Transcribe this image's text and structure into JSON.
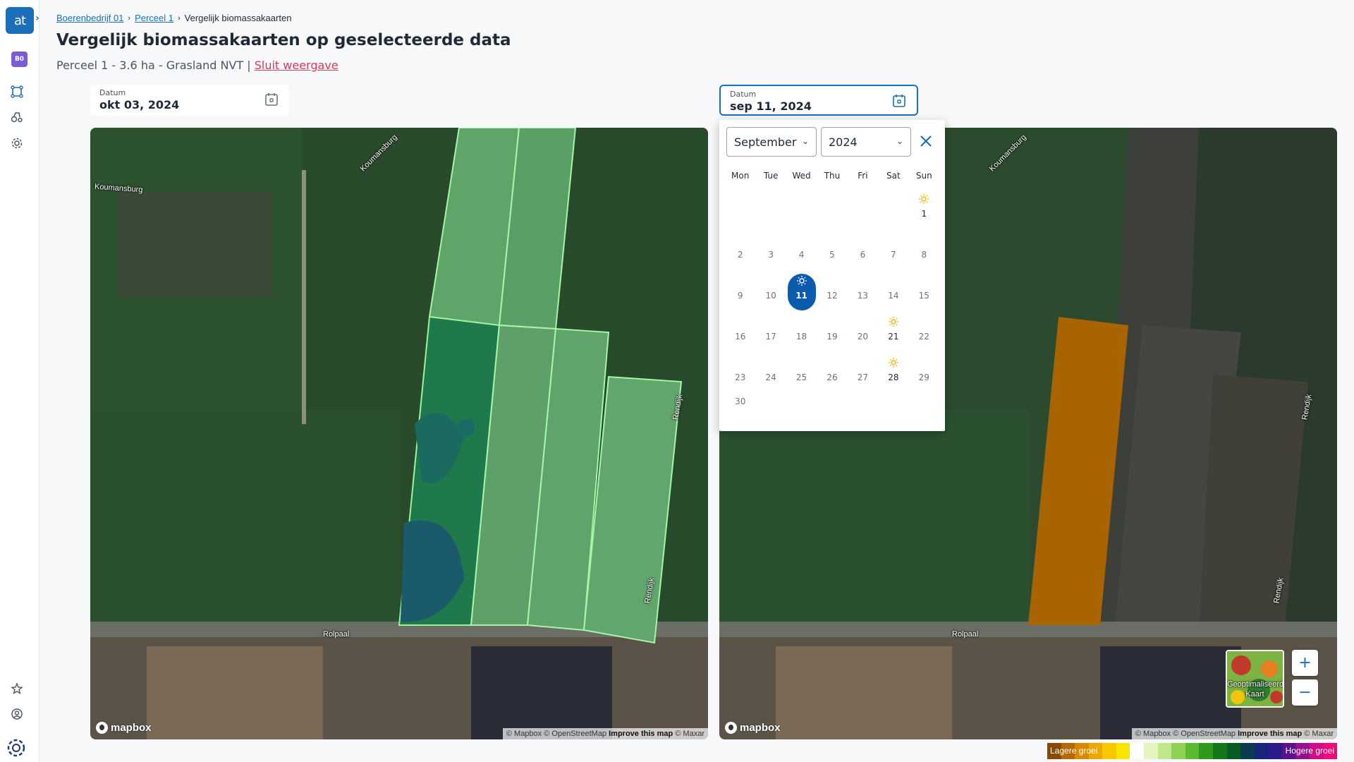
{
  "app": {
    "logo_text": "at",
    "farm_badge": "B0"
  },
  "breadcrumb": {
    "items": [
      "Boerenbedrijf 01",
      "Perceel 1",
      "Vergelijk biomassakaarten"
    ]
  },
  "page": {
    "title": "Vergelijk biomassakaarten op geselecteerde data",
    "subtitle": "Perceel 1 - 3.6 ha - Grasland NVT",
    "subtitle_sep": "|",
    "close_link": "Sluit weergave"
  },
  "left_date": {
    "label": "Datum",
    "value": "okt 03, 2024"
  },
  "right_date": {
    "label": "Datum",
    "value": "sep 11, 2024"
  },
  "map": {
    "labels": {
      "koumansburg": "Koumansburg",
      "rolpaal": "Rolpaal",
      "rendijk": "Rendijk"
    },
    "logo": "mapbox",
    "attribution": {
      "mapbox": "© Mapbox",
      "osm": "© OpenStreetMap",
      "improve": "Improve this map",
      "maxar": "© Maxar"
    }
  },
  "calendar": {
    "month": "September",
    "year": "2024",
    "weekdays": [
      "Mon",
      "Tue",
      "Wed",
      "Thu",
      "Fri",
      "Sat",
      "Sun"
    ],
    "days": [
      "1",
      "2",
      "3",
      "4",
      "5",
      "6",
      "7",
      "8",
      "9",
      "10",
      "11",
      "12",
      "13",
      "14",
      "15",
      "16",
      "17",
      "18",
      "19",
      "20",
      "21",
      "22",
      "23",
      "24",
      "25",
      "26",
      "27",
      "28",
      "29",
      "30"
    ],
    "selected_day": "11",
    "days_with_imagery": [
      "1",
      "11",
      "21",
      "28"
    ],
    "accent_color": "#0b5cad",
    "sun_color": "#f2b705"
  },
  "layer_control": {
    "label": "Geoptimaliseerde Kaart"
  },
  "zoom": {
    "in": "+",
    "out": "−"
  },
  "legend": {
    "low": "Lagere groei",
    "high": "Hogere groei",
    "colors": [
      "#8a4a00",
      "#b56a00",
      "#d98900",
      "#eda800",
      "#f8c800",
      "#f6e600",
      "#ffffff",
      "#e6f5c0",
      "#c0e88a",
      "#8fd255",
      "#5bbb2e",
      "#2e9a1c",
      "#14781a",
      "#0a5a24",
      "#0a3a50",
      "#16257a",
      "#2a1b8a",
      "#5b118f",
      "#95108a",
      "#d30c86",
      "#f00a78"
    ]
  }
}
